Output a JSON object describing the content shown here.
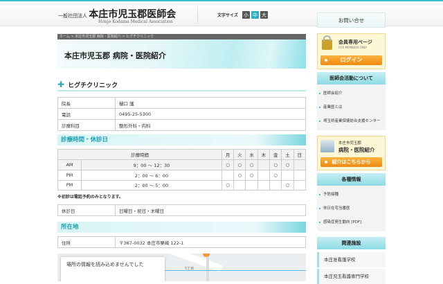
{
  "header": {
    "org_prefix": "一般社団法人",
    "org_name": "本庄市児玉郡医師会",
    "org_en": "Honjo Kodama Medical Association",
    "font_size_label": "文字サイズ",
    "font_sizes": [
      "小",
      "中",
      "大"
    ]
  },
  "breadcrumb": "ホーム > 本庄市児玉郡 病院・医院紹介 > ヒグチクリニック",
  "banner_title": "本庄市児玉郡 病院・医院紹介",
  "clinic_name": "ヒグチクリニック",
  "info": [
    {
      "k": "院長",
      "v": "樋口 護"
    },
    {
      "k": "電話",
      "v": "0495-25-5300"
    },
    {
      "k": "診療科目",
      "v": "整形外科・内科"
    }
  ],
  "hours_heading": "診療時間・休診日",
  "schedule": {
    "header": [
      "診療時間",
      "月",
      "火",
      "水",
      "木",
      "金",
      "土",
      "日"
    ],
    "rows": [
      [
        "AM",
        "9：00 〜 12：30",
        "○",
        "○",
        "○",
        "",
        "○",
        "○",
        ""
      ],
      [
        "PM",
        "2：00 〜 6：00",
        "",
        "○",
        "○",
        "",
        "○",
        "",
        ""
      ],
      [
        "PM",
        "2：00 〜 5：00",
        "○",
        "",
        "",
        "",
        "",
        "○",
        ""
      ]
    ]
  },
  "note": "※初診は電話予約のみとなります。",
  "holiday": {
    "k": "休診日",
    "v": "日曜日・祝日・木曜日"
  },
  "location_heading": "所在地",
  "address": {
    "k": "住所",
    "v": "〒367-0032 本庄市栗崎 122-1"
  },
  "map": {
    "error": "場所の情報を読み込めませんでした",
    "label1": "5丁目"
  },
  "sidebar": {
    "contact": "お問い合せ",
    "members_title": "会員専用ページ",
    "members_sub": "FOR MEMBERS ONLY",
    "login": "ログイン",
    "activities_heading": "医師会活動について",
    "activities": [
      "医師会紹介",
      "産業医とは",
      "埼玉県産業保健総合支援センター"
    ],
    "hosp_small": "本庄市児玉郡",
    "hosp_big": "病院・医院紹介",
    "hosp_btn": "紹介はこちらから",
    "info_heading": "各種情報",
    "info_items": [
      "予防接種",
      "休日在宅当番医",
      "感染症発生動向 [PDF]"
    ],
    "related_heading": "関連施設",
    "related": [
      "本庄准看護学校",
      "本庄児玉看護専門学校"
    ]
  }
}
